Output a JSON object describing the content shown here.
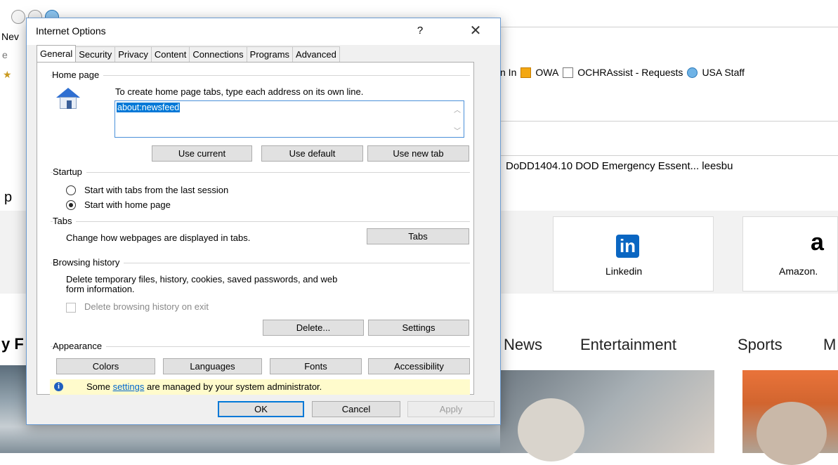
{
  "browser": {
    "partial_tab_text": "Nev",
    "partial_left_char": "e",
    "left_cut_p": "p",
    "left_cut_y": "y F",
    "favorites": [
      {
        "label": "n In",
        "icon": "bookmark-icon"
      },
      {
        "label": "OWA",
        "icon": "outlook-icon"
      },
      {
        "label": "OCHRAssist - Requests",
        "icon": "page-icon"
      },
      {
        "label": "USA Staff",
        "icon": "ie-icon"
      }
    ],
    "links_row": "DoDD1404.10   DOD Emergency Essent...   leesbu",
    "tiles": [
      {
        "label": "Linkedin",
        "logo": "in"
      },
      {
        "label": "Amazon.",
        "logo": "a"
      }
    ],
    "news_nav": [
      "News",
      "Entertainment",
      "Sports",
      "M"
    ]
  },
  "dialog": {
    "title": "Internet Options",
    "help_glyph": "?",
    "close_glyph": "✕",
    "tabs": [
      "General",
      "Security",
      "Privacy",
      "Content",
      "Connections",
      "Programs",
      "Advanced"
    ],
    "home_page": {
      "group_label": "Home page",
      "instruction": "To create home page tabs, type each address on its own line.",
      "value": "about:newsfeed",
      "buttons": {
        "use_current": "Use current",
        "use_default": "Use default",
        "use_new_tab": "Use new tab"
      }
    },
    "startup": {
      "group_label": "Startup",
      "option_last_session": "Start with tabs from the last session",
      "option_home_page": "Start with home page",
      "selected": "home_page"
    },
    "tabs_group": {
      "group_label": "Tabs",
      "description": "Change how webpages are displayed in tabs.",
      "button": "Tabs"
    },
    "browsing_history": {
      "group_label": "Browsing history",
      "description_line1": "Delete temporary files, history, cookies, saved passwords, and web",
      "description_line2": "form information.",
      "checkbox_label": "Delete browsing history on exit",
      "checkbox_checked": false,
      "delete_button": "Delete...",
      "settings_button": "Settings"
    },
    "appearance": {
      "group_label": "Appearance",
      "buttons": {
        "colors": "Colors",
        "languages": "Languages",
        "fonts": "Fonts",
        "accessibility": "Accessibility"
      }
    },
    "info": {
      "prefix": "Some ",
      "link": "settings",
      "suffix": " are managed by your system administrator."
    },
    "footer": {
      "ok": "OK",
      "cancel": "Cancel",
      "apply": "Apply"
    }
  }
}
